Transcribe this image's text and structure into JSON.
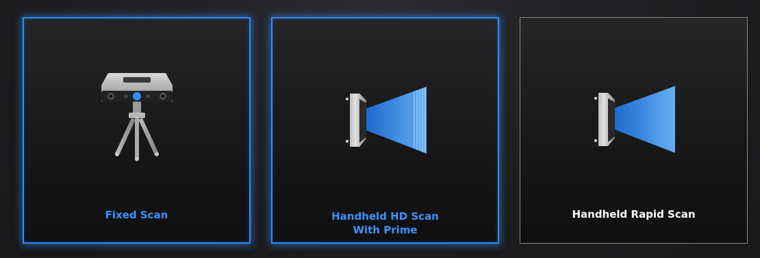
{
  "modes": [
    {
      "label_line1": "Fixed Scan",
      "label_line2": "",
      "selected": true,
      "icon": "tripod-scanner-icon"
    },
    {
      "label_line1": "Handheld HD Scan",
      "label_line2": "With Prime",
      "selected": true,
      "icon": "handheld-scanner-hd-icon"
    },
    {
      "label_line1": "Handheld Rapid Scan",
      "label_line2": "",
      "selected": false,
      "icon": "handheld-scanner-rapid-icon"
    }
  ],
  "colors": {
    "accent": "#2f8dff",
    "label_selected": "#3a93ff",
    "label_default": "#ffffff",
    "beam": "#4aa3ff"
  }
}
